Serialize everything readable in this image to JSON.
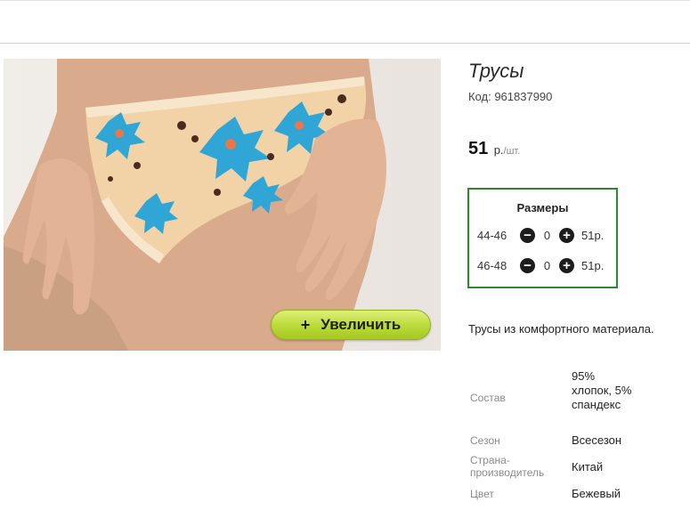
{
  "product": {
    "title": "Трусы",
    "code_label": "Код: 961837990",
    "price_value": "51",
    "price_unit": "р.",
    "price_per": "/шт.",
    "zoom_label": "Увеличить",
    "zoom_plus": "+",
    "description": "Трусы из комфортного материала."
  },
  "sizes": {
    "title": "Размеры",
    "minus_symbol": "−",
    "plus_symbol": "+",
    "rows": [
      {
        "label": "44-46",
        "qty": "0",
        "price": "51р."
      },
      {
        "label": "46-48",
        "qty": "0",
        "price": "51р."
      }
    ]
  },
  "attributes": [
    {
      "label": "Состав",
      "value": "95% хлопок, 5% спандекс"
    },
    {
      "label": "Сезон",
      "value": "Всесезон"
    },
    {
      "label": "Страна-производитель",
      "value": "Китай"
    },
    {
      "label": "Цвет",
      "value": "Бежевый"
    }
  ],
  "colors": {
    "accent_border": "#2b8a2b",
    "zoom_button": "#bcdc3c"
  },
  "icons": [
    "minus-icon",
    "plus-icon"
  ]
}
